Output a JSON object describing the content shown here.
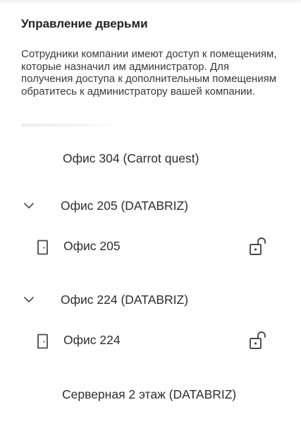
{
  "header": {
    "title": "Управление дверьми",
    "description": "Сотрудники компании имеют доступ к помещениям, которые назначил им администратор. Для получения доступа к дополнительным помещениям обратитесь к администратору вашей компании."
  },
  "rooms": {
    "office_304": {
      "label": "Офис 304 (Carrot quest)"
    },
    "group_205": {
      "label": "Офис 205 (DATABRIZ)",
      "expanded": true,
      "icon": "chevron-down-icon"
    },
    "door_205": {
      "label": "Офис 205",
      "icon": "door-icon",
      "lock_icon": "unlocked-padlock-icon"
    },
    "group_224": {
      "label": "Офис 224 (DATABRIZ)",
      "expanded": true,
      "icon": "chevron-down-icon"
    },
    "door_224": {
      "label": "Офис 224",
      "icon": "door-icon",
      "lock_icon": "unlocked-padlock-icon"
    },
    "server_room": {
      "label": "Серверная 2 этаж (DATABRIZ)"
    }
  },
  "colors": {
    "text": "#2e2e2e",
    "icon": "#4a4a4a",
    "title": "#222222"
  }
}
